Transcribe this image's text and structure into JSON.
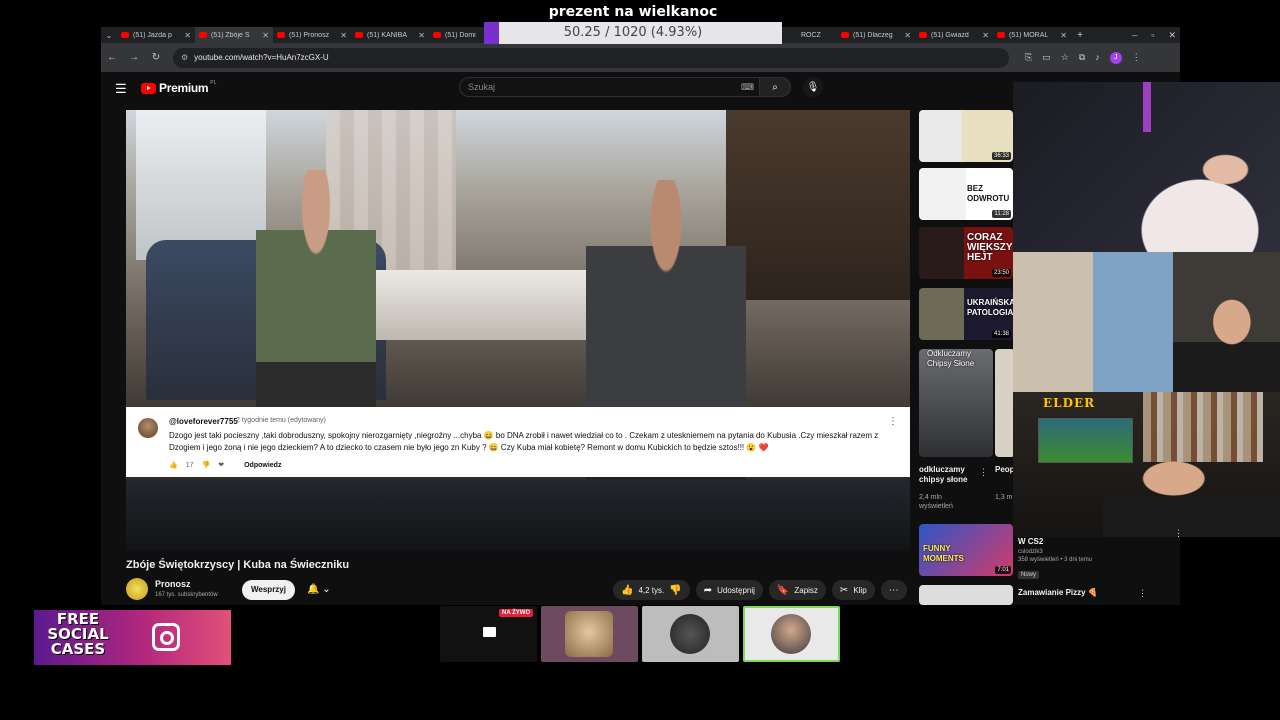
{
  "goal": {
    "title": "prezent na wielkanoc",
    "progress_text": "50.25 / 1020 (4.93%)",
    "progress_fraction": 0.0493,
    "fill_color": "#7a2fd1"
  },
  "browser": {
    "tabs": [
      {
        "label": "(51) Jazda p"
      },
      {
        "label": "(51) Zbóje Ś"
      },
      {
        "label": "(51) Pronosz"
      },
      {
        "label": "(51) KANIBA"
      },
      {
        "label": "(51) Domi"
      },
      {
        "label": "ROCZ"
      },
      {
        "label": "(51) Dlaczeg"
      },
      {
        "label": "(51) Gwiazd"
      },
      {
        "label": "(51) MORAL"
      }
    ],
    "url": "youtube.com/watch?v=HuAn7zcGX-U"
  },
  "youtube": {
    "brand": "Premium",
    "region": "PL",
    "search_placeholder": "Szukaj",
    "video_title": "Zbóje Świętokrzyscy | Kuba na Świeczniku",
    "channel": {
      "name": "Pronosz",
      "subs": "167 tys. subskrybentów"
    },
    "support_label": "Wesprzyj",
    "actions": {
      "likes": "4,2 tys.",
      "share": "Udostępnij",
      "save": "Zapisz",
      "clip": "Klip"
    }
  },
  "comment": {
    "author": "@loveforever7755",
    "meta": "2 tygodnie temu (edytowany)",
    "text": "Dzogo jest taki pocieszny ,taki dobroduszny, spokojny nierozgarnięty ,niegroźny ...chyba 😄 bo DNA zrobił i nawet wiedział co to . Czekam z uteskniemem na pytania do Kubusia .Czy mieszkał razem z Dzogiem i jego żoną i nie jego dzieckiem? A to dziecko to czasem nie było jego zn Kuby ? 😄 Czy Kuba miał kobietę? Remont w domu Kubickich to będzie sztos!!! 😮 ❤️",
    "likes": "17",
    "reply_label": "Odpowiedz"
  },
  "recommendations": [
    {
      "duration": "36:33",
      "thumb_text": ""
    },
    {
      "duration": "11:28",
      "thumb_text": "BEZ ODWROTU"
    },
    {
      "duration": "23:50",
      "thumb_text": "CORAZ WIĘKSZY HEJT"
    },
    {
      "duration": "41:38",
      "thumb_text": "UKRAIŃSKA PATOLOGIA"
    },
    {
      "thumb_text": "Odkluczamy Chipsy Słone",
      "title": "odkluczamy chipsy słone",
      "views": "2,4 mln wyświetleń"
    },
    {
      "title": "Peop Actu",
      "views": "1,3 m wyśw"
    },
    {
      "duration": "7:01",
      "thumb_text": "FUNNY MOMENTS",
      "title": "W CS2",
      "channel": "cslodzik3",
      "views": "358 wyświetleń • 3 dni temu",
      "badge": "Nowy"
    },
    {
      "title": "Zamawianie Pizzy 🍕"
    }
  ],
  "overlays": {
    "cam3_logo": "ELDER",
    "promo_text": "FREE SOCIAL CASES",
    "live_badge": "NA ŻYWO"
  },
  "icons": {
    "menu": "hamburger-icon",
    "search": "search-icon",
    "mic": "mic-icon",
    "bell": "bell-icon",
    "like": "thumb-up-icon",
    "dislike": "thumb-down-icon",
    "share": "share-icon",
    "save": "bookmark-icon",
    "clip": "scissors-icon",
    "more": "more-icon"
  }
}
